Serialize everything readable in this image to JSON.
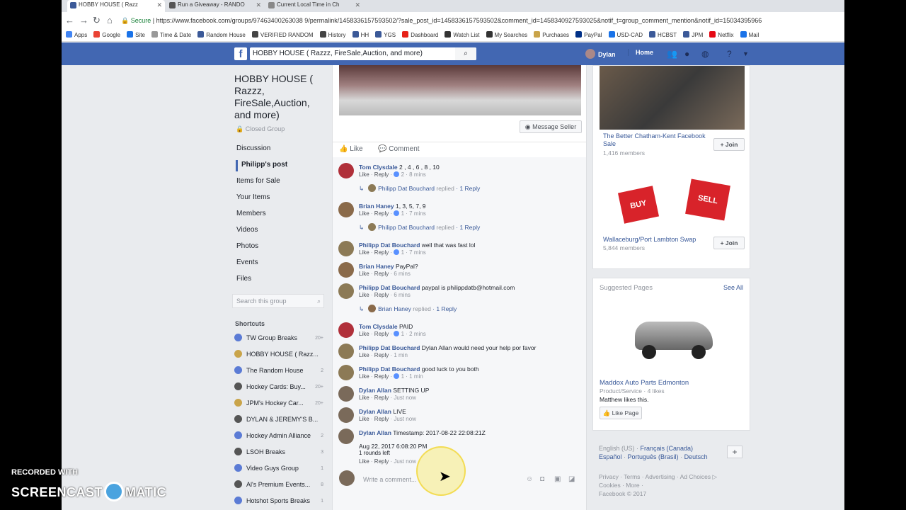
{
  "browser": {
    "tabs": [
      {
        "title": "HOBBY HOUSE ( Razz",
        "color": "#3b5998"
      },
      {
        "title": "Run a Giveaway - RANDO",
        "color": "#555"
      },
      {
        "title": "Current Local Time in Ch",
        "color": "#888"
      }
    ],
    "secure": "Secure",
    "url": "https://www.facebook.com/groups/97463400263038 9/permalink/1458336157593502/?sale_post_id=1458336157593502&comment_id=1458340927593025&notif_t=group_comment_mention&notif_id=15034395966",
    "bookmarks": [
      "Apps",
      "Google",
      "Site",
      "Time & Date",
      "Random House",
      "VERIFIED RANDOM",
      "History",
      "HH",
      "YGS",
      "Dashboard",
      "Watch List",
      "My Searches",
      "Purchases",
      "PayPal",
      "USD-CAD",
      "HCBST",
      "JPM",
      "Netflix",
      "Mail"
    ]
  },
  "fb": {
    "search_value": "HOBBY HOUSE ( Razzz, FireSale,Auction, and more)",
    "user": "Dylan",
    "home": "Home"
  },
  "group": {
    "name": "HOBBY HOUSE ( Razzz, FireSale,Auction, and more)",
    "privacy": "Closed Group",
    "nav": [
      "Discussion",
      "Philipp's post",
      "Items for Sale",
      "Your Items",
      "Members",
      "Videos",
      "Photos",
      "Events",
      "Files"
    ],
    "search_placeholder": "Search this group",
    "shortcuts_title": "Shortcuts",
    "shortcuts": [
      {
        "label": "TW Group Breaks",
        "count": "20+",
        "color": "#5b7bd5"
      },
      {
        "label": "HOBBY HOUSE ( Razz...",
        "count": "",
        "color": "#c9a44a"
      },
      {
        "label": "The Random House",
        "count": "2",
        "color": "#5b7bd5"
      },
      {
        "label": "Hockey Cards: Buy...",
        "count": "20+",
        "color": "#555"
      },
      {
        "label": "JPM's Hockey Car...",
        "count": "20+",
        "color": "#c9a44a"
      },
      {
        "label": "DYLAN & JEREMY'S B...",
        "count": "",
        "color": "#555"
      },
      {
        "label": "Hockey Admin Alliance",
        "count": "2",
        "color": "#5b7bd5"
      },
      {
        "label": "LSOH Breaks",
        "count": "3",
        "color": "#555"
      },
      {
        "label": "Video Guys Group",
        "count": "1",
        "color": "#5b7bd5"
      },
      {
        "label": "Al's Premium Events...",
        "count": "8",
        "color": "#555"
      },
      {
        "label": "Hotshot Sports Breaks",
        "count": "1",
        "color": "#5b7bd5"
      }
    ]
  },
  "post": {
    "message_seller": "Message Seller",
    "like": "Like",
    "comment": "Comment",
    "comments": [
      {
        "name": "Tom Clysdale",
        "text": "2 , 4 , 6 , 8 , 10",
        "like": "Like",
        "reply": "Reply",
        "reacts": "2",
        "time": "8 mins"
      },
      {
        "name": "Brian Haney",
        "text": "1, 3, 5, 7, 9",
        "like": "Like",
        "reply": "Reply",
        "reacts": "1",
        "time": "7 mins"
      },
      {
        "name": "Philipp Dat Bouchard",
        "text": "well that was fast lol",
        "like": "Like",
        "reply": "Reply",
        "reacts": "1",
        "time": "7 mins"
      },
      {
        "name": "Brian Haney",
        "text": "PayPal?",
        "like": "Like",
        "reply": "Reply",
        "reacts": "",
        "time": "6 mins"
      },
      {
        "name": "Philipp Dat Bouchard",
        "text": "paypal is philippdatb@hotmail.com",
        "like": "Like",
        "reply": "Reply",
        "reacts": "",
        "time": "6 mins"
      },
      {
        "name": "Tom Clysdale",
        "text": "PAID",
        "like": "Like",
        "reply": "Reply",
        "reacts": "1",
        "time": "2 mins"
      },
      {
        "name": "Philipp Dat Bouchard",
        "text": "Dylan Allan would need your help por favor",
        "like": "Like",
        "reply": "Reply",
        "reacts": "",
        "time": "1 min"
      },
      {
        "name": "Philipp Dat Bouchard",
        "text": "good luck to you both",
        "like": "Like",
        "reply": "Reply",
        "reacts": "1",
        "time": "1 min"
      },
      {
        "name": "Dylan Allan",
        "text": "SETTING UP",
        "like": "Like",
        "reply": "Reply",
        "reacts": "",
        "time": "Just now"
      },
      {
        "name": "Dylan Allan",
        "text": "LIVE",
        "like": "Like",
        "reply": "Reply",
        "reacts": "",
        "time": "Just now"
      },
      {
        "name": "Dylan Allan",
        "text": "Timestamp: 2017-08-22 22:08:21Z",
        "line2": "Aug 22, 2017 6:08:20 PM",
        "line3": "1 rounds left",
        "like": "Like",
        "reply": "Reply",
        "reacts": "",
        "time": "Just now"
      }
    ],
    "replies": [
      {
        "who": "Philipp Dat Bouchard",
        "action": "replied",
        "count": "1 Reply"
      },
      {
        "who": "Philipp Dat Bouchard",
        "action": "replied",
        "count": "1 Reply"
      },
      {
        "who": "Brian Haney",
        "action": "replied",
        "count": "1 Reply"
      }
    ],
    "write_placeholder": "Write a comment..."
  },
  "right": {
    "groups": [
      {
        "name": "The Better Chatham-Kent Facebook Sale",
        "members": "1,416 members",
        "join": "Join"
      },
      {
        "name": "Wallaceburg/Port Lambton Swap",
        "members": "5,844 members",
        "join": "Join"
      }
    ],
    "sug_title": "Suggested Pages",
    "see_all": "See All",
    "page_name": "Maddox Auto Parts Edmonton",
    "page_type": "Product/Service",
    "page_likes": "4 likes",
    "friend_like": "Matthew likes this.",
    "like_page": "Like Page",
    "langs": {
      "current": "English (US)",
      "others": [
        "Français (Canada)",
        "Español",
        "Português (Brasil)",
        "Deutsch"
      ]
    },
    "footer_lines": [
      "Privacy · Terms · Advertising · Ad Choices ▷",
      "Cookies · More ·",
      "Facebook © 2017"
    ]
  },
  "overlay": {
    "line1": "RECORDED WITH",
    "line2a": "SCREENCAST",
    "line2b": "MATIC"
  }
}
